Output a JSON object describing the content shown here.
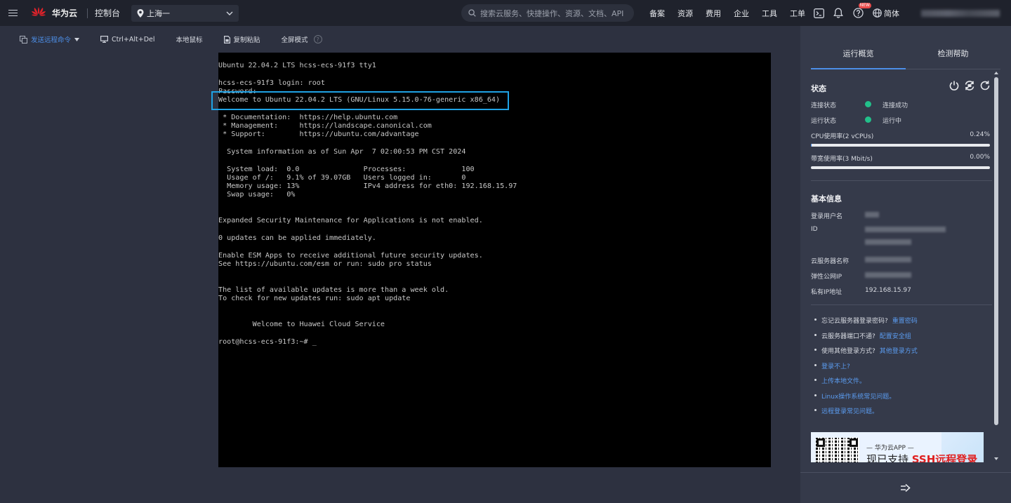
{
  "nav": {
    "brand": "华为云",
    "console": "控制台",
    "region": "上海一",
    "search_placeholder": "搜索云服务、快捷操作、资源、文档、API",
    "links": [
      "备案",
      "资源",
      "费用",
      "企业",
      "工具",
      "工单"
    ],
    "new_badge": "NEW",
    "lang": "简体"
  },
  "toolbar": {
    "send_command": "发送远程命令",
    "ctrl_alt_del": "Ctrl+Alt+Del",
    "local_mouse": "本地鼠标",
    "copy_paste": "复制粘贴",
    "fullscreen": "全屏模式",
    "help": "?"
  },
  "terminal": {
    "lines": [
      "Ubuntu 22.04.2 LTS hcss-ecs-91f3 tty1",
      "",
      "hcss-ecs-91f3 login: root",
      "Password:",
      "Welcome to Ubuntu 22.04.2 LTS (GNU/Linux 5.15.0-76-generic x86_64)",
      "",
      " * Documentation:  https://help.ubuntu.com",
      " * Management:     https://landscape.canonical.com",
      " * Support:        https://ubuntu.com/advantage",
      "",
      "  System information as of Sun Apr  7 02:00:53 PM CST 2024",
      "",
      "  System load:  0.0               Processes:             100",
      "  Usage of /:   9.1% of 39.07GB   Users logged in:       0",
      "  Memory usage: 13%               IPv4 address for eth0: 192.168.15.97",
      "  Swap usage:   0%",
      "",
      "",
      "Expanded Security Maintenance for Applications is not enabled.",
      "",
      "0 updates can be applied immediately.",
      "",
      "Enable ESM Apps to receive additional future security updates.",
      "See https://ubuntu.com/esm or run: sudo pro status",
      "",
      "",
      "The list of available updates is more than a week old.",
      "To check for new updates run: sudo apt update",
      "",
      "",
      "        Welcome to Huawei Cloud Service",
      "",
      "root@hcss-ecs-91f3:~# _"
    ]
  },
  "panel": {
    "tabs": [
      "运行概览",
      "检测帮助"
    ],
    "status": {
      "title": "状态",
      "connection_label": "连接状态",
      "connection_value": "连接成功",
      "running_label": "运行状态",
      "running_value": "运行中",
      "cpu_label": "CPU使用率(2 vCPUs)",
      "cpu_pct": "0.24%",
      "cpu_fraction": 0.0024,
      "bw_label": "带宽使用率(3 Mbit/s)",
      "bw_pct": "0.00%",
      "bw_fraction": 0.0
    },
    "info": {
      "title": "基本信息",
      "user_label": "登录用户名",
      "id_label": "ID",
      "server_name_label": "云服务器名称",
      "eip_label": "弹性公网IP",
      "private_ip_label": "私有IP地址",
      "private_ip": "192.168.15.97"
    },
    "help": {
      "forgot_pw": "忘记云服务器登录密码?",
      "reset_pw": "重置密码",
      "port_blocked": "云服务器端口不通?",
      "config_sg": "配置安全组",
      "other_login_q": "使用其他登录方式?",
      "other_login": "其他登录方式",
      "cannot_login": "登录不上?",
      "upload_file": "上传本地文件。",
      "linux_faq": "Linux操作系统常见问题。",
      "remote_faq": "远程登录常见问题。"
    },
    "ad": {
      "sub": "— 华为云APP —",
      "main_prefix": "现已支持 ",
      "main_red": "SSH远程登录"
    }
  },
  "colors": {
    "accent": "#4d8fe8",
    "success": "#22c08a",
    "highlight_box": "#1fa2e4"
  }
}
